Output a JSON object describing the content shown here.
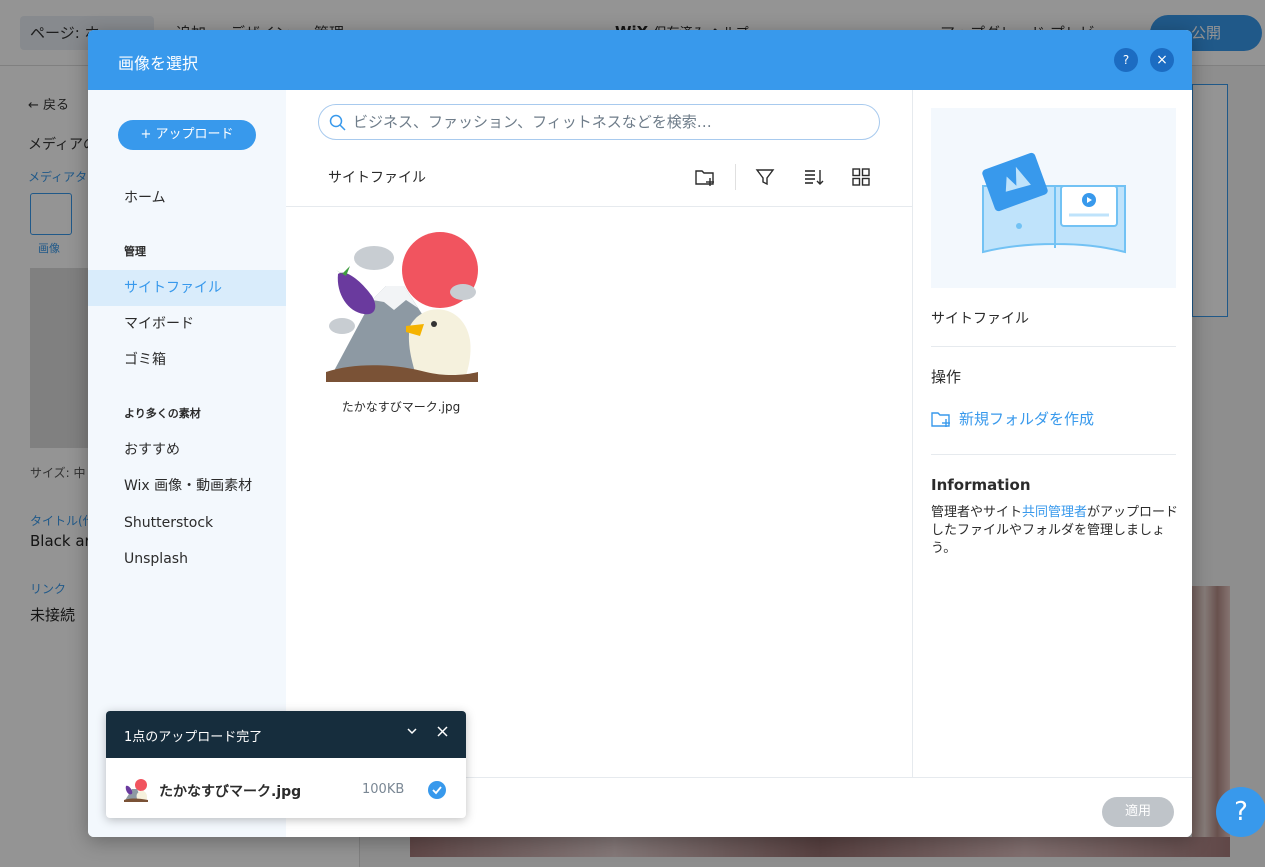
{
  "editor": {
    "page_selector": "ページ: ホ",
    "menu": [
      "追加",
      "デザイン",
      "管理"
    ],
    "brand": "WiX",
    "brand_rest": "保存済み ヘルプ",
    "upgrade": "アップグレード プレビュー",
    "publish": "公開",
    "back": "← 戻る",
    "panel_title": "メディアの",
    "media_type": "メディアタイ",
    "thumb_label": "画像",
    "size": "サイズ: 中",
    "title_label": "タイトル(代",
    "title_value": "Black ar",
    "link_label": "リンク",
    "link_value": "未接続",
    "help": "?"
  },
  "modal": {
    "title": "画像を選択",
    "help": "?",
    "close": "×"
  },
  "sidebar": {
    "upload": "+ アップロード",
    "home": "ホーム",
    "manage_header": "管理",
    "site_files": "サイトファイル",
    "my_boards": "マイボード",
    "trash": "ゴミ箱",
    "more_header": "より多くの素材",
    "recommended": "おすすめ",
    "wix_media": "Wix 画像・動画素材",
    "shutterstock": "Shutterstock",
    "unsplash": "Unsplash"
  },
  "main": {
    "search_placeholder": "ビジネス、ファッション、フィットネスなどを検索…",
    "breadcrumb": "サイトファイル",
    "file_name": "たかなすびマーク.jpg"
  },
  "info": {
    "folder_name": "サイトファイル",
    "ops_header": "操作",
    "new_folder": "新規フォルダを作成",
    "info_header": "Information",
    "text_a": "管理者やサイト",
    "text_link": "共同管理者",
    "text_b": "がアップロードしたファイルやフォルダを管理しましょう。"
  },
  "footer": {
    "apply": "適用"
  },
  "toast": {
    "title": "1点のアップロード完了",
    "file": "たかなすびマーク.jpg",
    "size": "100KB"
  },
  "colors": {
    "accent": "#3899ec",
    "toast_header": "#162d3d",
    "sidebar_bg": "#f3f8fd",
    "apply_disabled": "#bfc4c9"
  }
}
